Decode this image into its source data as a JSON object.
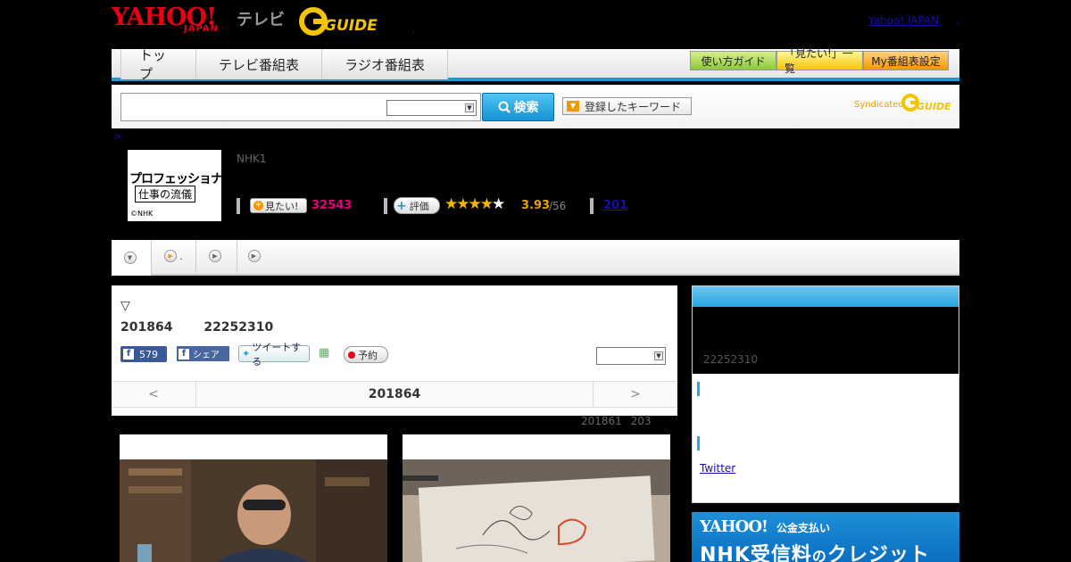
{
  "header": {
    "yahoo_logo": "YAHOO!",
    "yahoo_japan": "JAPAN",
    "tv_label": "テレビ",
    "gguide_logo": "G GUIDE",
    "top_link": "Yahoo! JAPAN",
    "top_dot": ".",
    "tiny_dot": ","
  },
  "nav": {
    "tabs": [
      {
        "label": "トップ"
      },
      {
        "label": "テレビ番組表"
      },
      {
        "label": "ラジオ番組表"
      }
    ],
    "buttons": [
      {
        "label": "使い方ガイド"
      },
      {
        "label": "「見たい!」一覧"
      },
      {
        "label": "My番組表設定"
      }
    ]
  },
  "search": {
    "input_value": "",
    "select_value": "",
    "button_label": "検索",
    "keyword_button": "登録したキーワード",
    "syndicated": "Syndicated"
  },
  "breadcrumb": ">",
  "program": {
    "logo_line1": "プロフェッショナル",
    "logo_line2": "仕事の流儀",
    "logo_copyright": "©NHK",
    "channel": "NHK1",
    "mitai_label": "見たい!",
    "mitai_count": "32543",
    "rate_label": "評価",
    "rating": "3.93",
    "rating_count": "/56",
    "review_count": "201",
    "stars_filled": 3.5,
    "stars_total": 5
  },
  "subtabs": [
    {
      "label": ""
    },
    {
      "label": "."
    },
    {
      "label": ""
    },
    {
      "label": ""
    }
  ],
  "episode": {
    "marker": "▽",
    "date_line": "201864 22252310",
    "fb_like_count": "579",
    "fb_share_label": "シェア",
    "tweet_label": "ツイートする",
    "reserve_label": "予約",
    "select_value": "",
    "pager_prev": "<",
    "pager_current": "201864",
    "pager_next": ">",
    "under_text": "201861 203"
  },
  "sidebar": {
    "time_text": "22252310",
    "twitter_link": "Twitter"
  },
  "banner": {
    "logo": "YAHOO!",
    "tagline": "公金支払い",
    "headline": "NHK受信料",
    "headline_small": "の",
    "headline_end": "クレジット"
  },
  "colors": {
    "accent_blue": "#1a9ad6",
    "yahoo_red": "#e60012",
    "mitai_pink": "#e4007f",
    "rating_orange": "#e8a000"
  }
}
